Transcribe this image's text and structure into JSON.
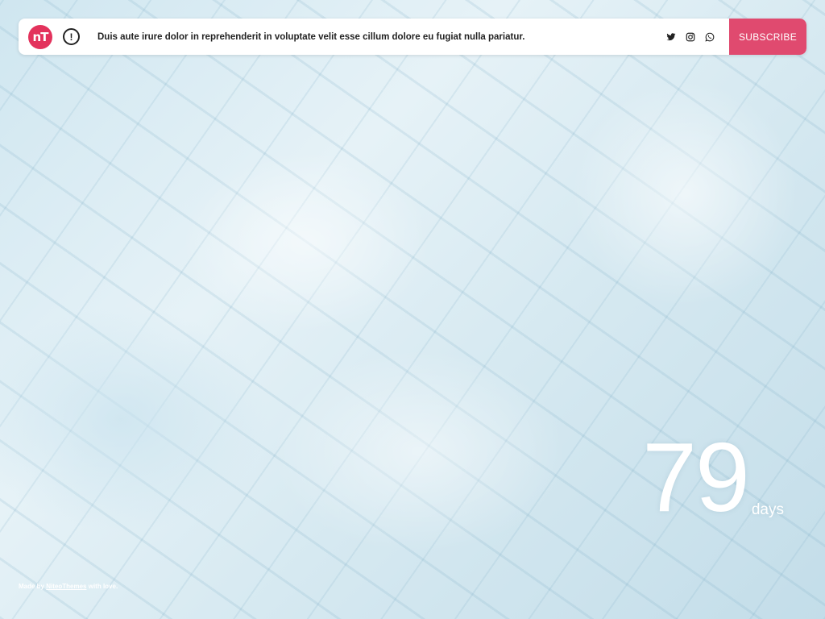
{
  "header": {
    "logo_text": "nT",
    "alert_symbol": "!",
    "message": "Duis aute irure dolor in reprehenderit in voluptate velit esse cillum dolore eu fugiat nulla pariatur.",
    "social_icons": [
      "twitter-icon",
      "instagram-icon",
      "whatsapp-icon"
    ],
    "subscribe_label": "SUBSCRIBE"
  },
  "countdown": {
    "value": "79",
    "unit": "days"
  },
  "footer": {
    "prefix": "Made by",
    "link_text": "NiteoThemes",
    "suffix": "with love."
  },
  "colors": {
    "brand": "#e3325c",
    "subscribe": "#e04a6f"
  }
}
